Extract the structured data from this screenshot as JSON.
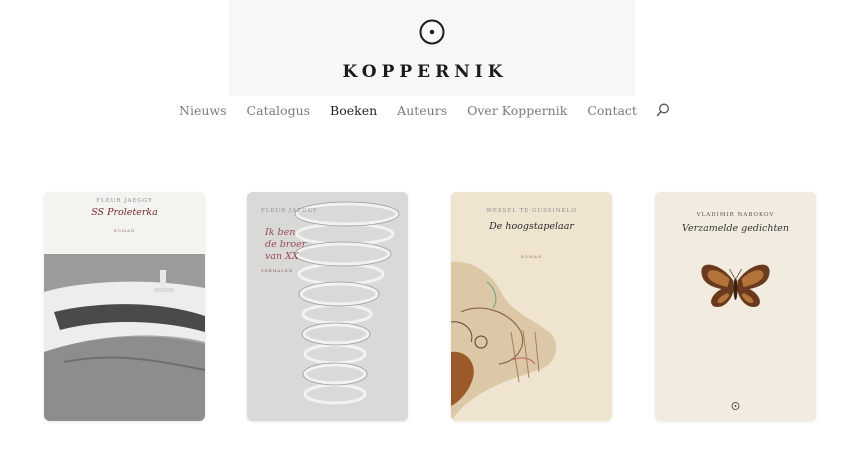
{
  "site": {
    "brand": "KOPPERNIK",
    "logo_icon": "circle-dot-logo-icon"
  },
  "nav": {
    "items": [
      {
        "label": "Nieuws"
      },
      {
        "label": "Catalogus"
      },
      {
        "label": "Boeken",
        "active": true
      },
      {
        "label": "Auteurs"
      },
      {
        "label": "Over Koppernik"
      },
      {
        "label": "Contact"
      }
    ],
    "search_icon": "search-icon"
  },
  "books": [
    {
      "author": "FLEUR JAEGGY",
      "title": "SS Proleterka",
      "subtitle": "ROMAN",
      "cover": "ship"
    },
    {
      "author": "FLEUR JAEGGY",
      "title_lines": [
        "Ik ben",
        "de broer",
        "van XX"
      ],
      "subtitle": "VERHALEN",
      "cover": "spiral"
    },
    {
      "author": "WESSEL TE GUSSINKLO",
      "title": "De hoogstapelaar",
      "subtitle": "ROMAN",
      "cover": "schiele"
    },
    {
      "author": "VLADIMIR NABOKOV",
      "title": "Verzamelde gedichten",
      "cover": "butterfly"
    }
  ],
  "colors": {
    "nav_text": "#7a7a7a",
    "nav_active": "#1e1e1e",
    "title_red": "#8a2a2a"
  }
}
